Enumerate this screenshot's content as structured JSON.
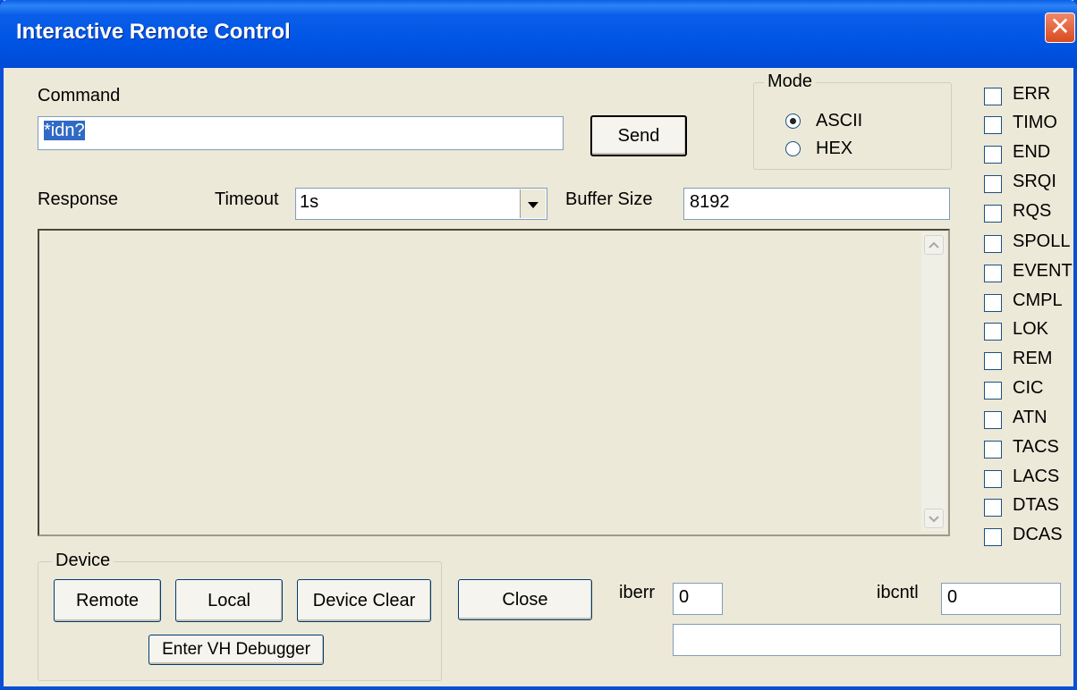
{
  "window": {
    "title": "Interactive Remote Control"
  },
  "command": {
    "label": "Command",
    "value": "*idn?",
    "send_label": "Send"
  },
  "mode": {
    "label": "Mode",
    "options": [
      "ASCII",
      "HEX"
    ],
    "selected": "ASCII"
  },
  "response": {
    "label": "Response",
    "text": ""
  },
  "timeout": {
    "label": "Timeout",
    "value": "1s"
  },
  "buffer": {
    "label": "Buffer Size",
    "value": "8192"
  },
  "status_flags": [
    "ERR",
    "TIMO",
    "END",
    "SRQI",
    "RQS",
    "SPOLL",
    "EVENT",
    "CMPL",
    "LOK",
    "REM",
    "CIC",
    "ATN",
    "TACS",
    "LACS",
    "DTAS",
    "DCAS"
  ],
  "device": {
    "label": "Device",
    "remote": "Remote",
    "local": "Local",
    "clear": "Device Clear",
    "debugger": "Enter VH Debugger"
  },
  "close_label": "Close",
  "iberr": {
    "label": "iberr",
    "value": "0"
  },
  "ibcntl": {
    "label": "ibcntl",
    "value": "0"
  },
  "status_text": ""
}
